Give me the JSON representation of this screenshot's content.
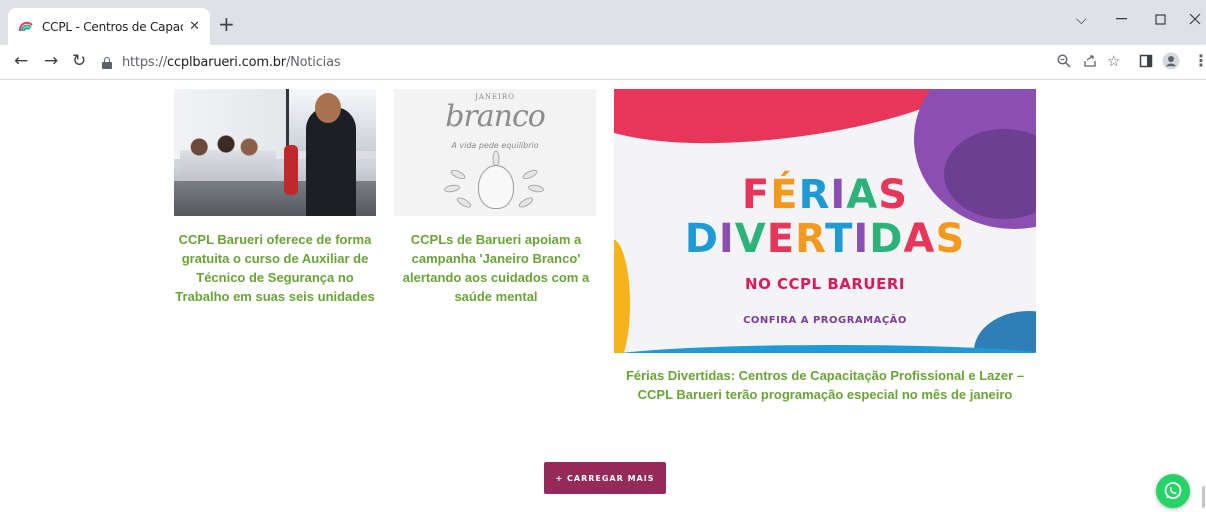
{
  "browser": {
    "tab_title": "CCPL - Centros de Capacitação P",
    "tab_close": "✕",
    "new_tab": "+",
    "url_scheme": "https://",
    "url_host": "ccplbarueri.com.br",
    "url_path": "/Noticias",
    "icons": [
      "back-arrow-icon",
      "forward-arrow-icon",
      "reload-icon",
      "lock-icon",
      "zoom-icon",
      "share-icon",
      "bookmark-star-icon",
      "side-panel-icon",
      "profile-icon",
      "menu-dots-icon",
      "minimize-icon",
      "maximize-icon",
      "close-window-icon",
      "tab-search-icon"
    ]
  },
  "news": [
    {
      "title": "CCPL Barueri oferece de forma gratuita o curso de Auxiliar de Técnico de Segurança no Trabalho em suas seis unidades"
    },
    {
      "title": "CCPLs de Barueri apoiam a campanha 'Janeiro Branco' alertando aos cuidados com a saúde mental",
      "image_text": {
        "top": "JANEIRO",
        "script": "branco",
        "tagline": "A vida pede equilíbrio"
      }
    },
    {
      "title": "Férias Divertidas: Centros de Capacitação Profissional e Lazer – CCPL Barueri terão programação especial no mês de janeiro",
      "image_text": {
        "line1": "FÉRIAS",
        "line2": "DIVERTIDAS",
        "line3": "NO CCPL BARUERI",
        "line4": "CONFIRA A PROGRAMAÇÃO"
      }
    }
  ],
  "load_more_label": "+ CARREGAR MAIS",
  "colors": {
    "title_green": "#6aa336",
    "button": "#962a5b",
    "whatsapp": "#25d366",
    "letters": [
      "#e8365b",
      "#f39a1e",
      "#1e9ad6",
      "#8a4fb0",
      "#2db37a"
    ]
  }
}
